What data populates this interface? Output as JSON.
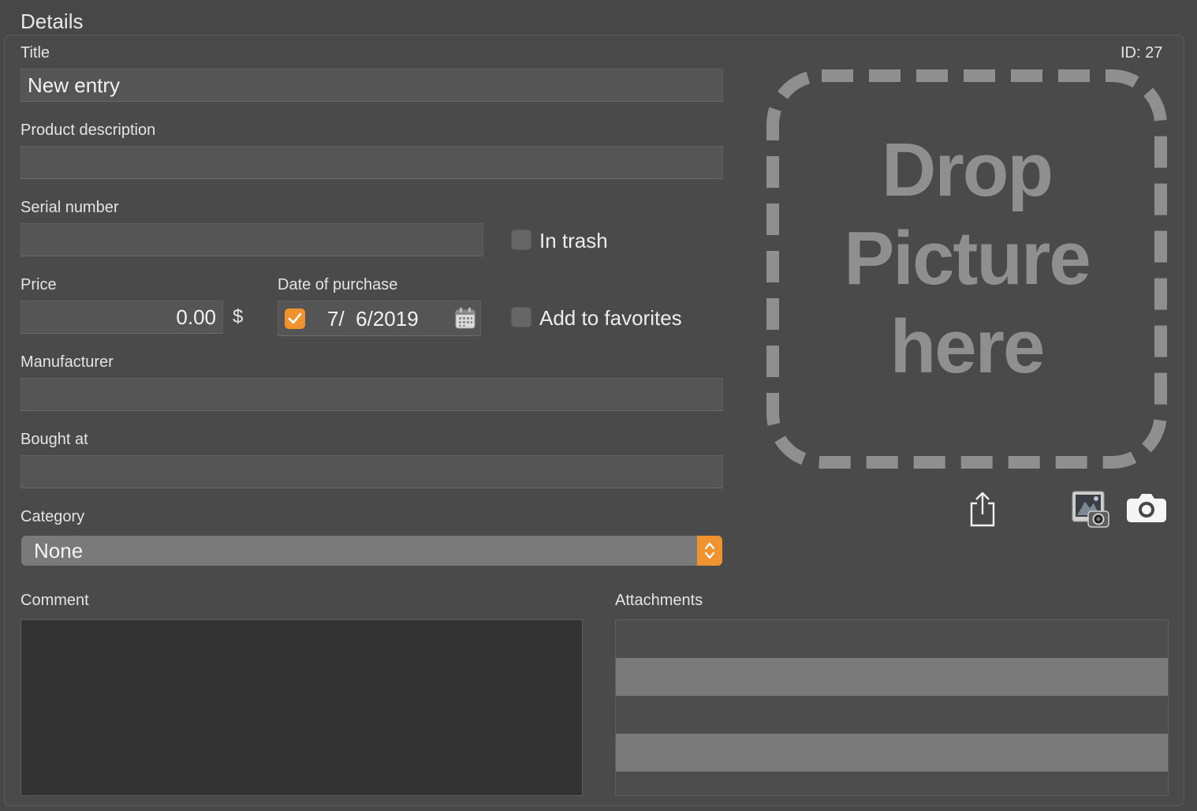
{
  "section_title": "Details",
  "id_label": "ID: 27",
  "fields": {
    "title": {
      "label": "Title",
      "value": "New entry"
    },
    "product_description": {
      "label": "Product description",
      "value": ""
    },
    "serial_number": {
      "label": "Serial number",
      "value": ""
    },
    "price": {
      "label": "Price",
      "value": "0.00",
      "currency": "$"
    },
    "date_of_purchase": {
      "label": "Date of purchase",
      "value": "7/  6/2019",
      "enabled": true
    },
    "manufacturer": {
      "label": "Manufacturer",
      "value": ""
    },
    "bought_at": {
      "label": "Bought at",
      "value": ""
    },
    "category": {
      "label": "Category",
      "selected": "None"
    },
    "comment": {
      "label": "Comment",
      "value": ""
    },
    "attachments": {
      "label": "Attachments",
      "rows": 5
    }
  },
  "checkboxes": {
    "in_trash": {
      "label": "In trash",
      "checked": false
    },
    "add_to_favorites": {
      "label": "Add to favorites",
      "checked": false
    }
  },
  "drop_area": {
    "lines": [
      "Drop",
      "Picture",
      "here"
    ]
  },
  "icons": {
    "share": "share-icon",
    "photo_booth": "photo-booth-icon",
    "camera": "camera-icon",
    "calendar": "calendar-icon"
  },
  "colors": {
    "accent": "#f0922e",
    "background": "#474747",
    "field": "#555555",
    "drop_text": "#8f8f8f"
  }
}
